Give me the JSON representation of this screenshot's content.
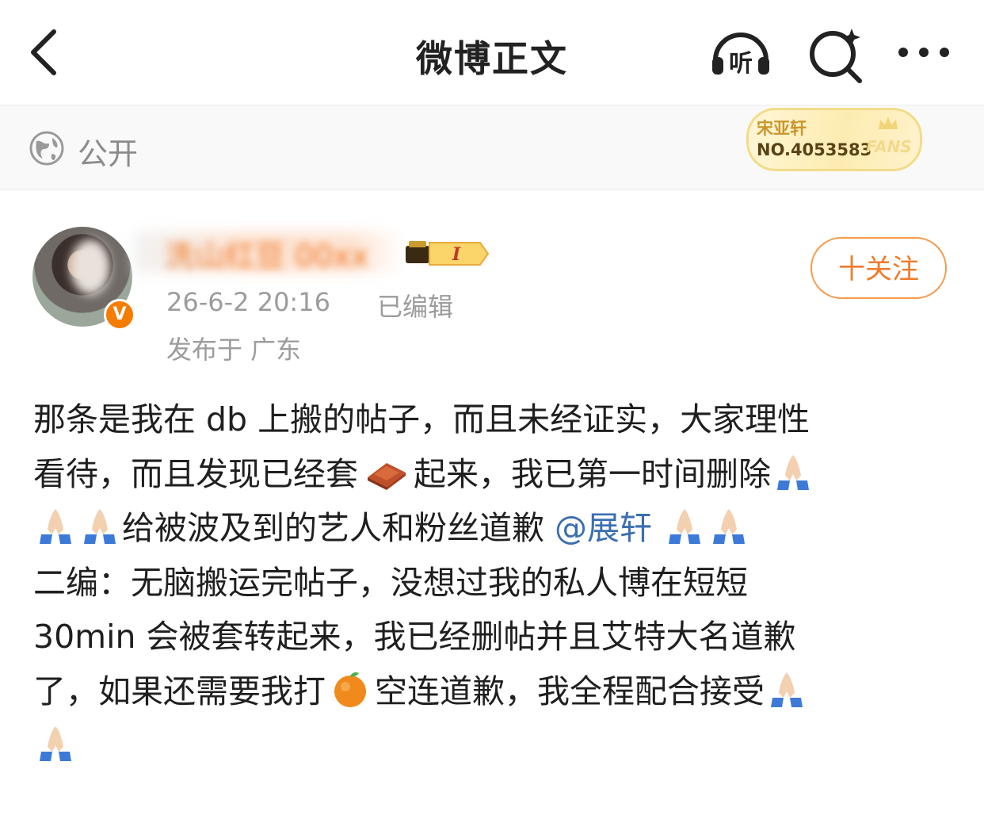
{
  "header": {
    "title": "微博正文",
    "listen_label": "听"
  },
  "visibility": {
    "label": "公开"
  },
  "fans_badge": {
    "name": "宋亚轩",
    "number": "NO.4053583",
    "mark": "FANS"
  },
  "author": {
    "name": "洗山红豆 00xx",
    "verified_mark": "V",
    "timestamp": "26-6-2 20:16",
    "edited": "已编辑",
    "location": "发布于 广东",
    "level_mark": "I"
  },
  "follow_button": {
    "label": "十关注"
  },
  "post": {
    "line1": "那条是我在 db 上搬的帖子，而且未经证实，大家理性",
    "line2a": "看待，而且发现已经套",
    "line2b": "起来，我已第一时间删除",
    "line3a": "给被波及到的艺人和粉丝道歉 ",
    "mention": "@展轩",
    "line4": "二编：无脑搬运完帖子，没想过我的私人博在短短",
    "line5": " 30min 会被套转起来，我已经删帖并且艾特大名道歉",
    "line6a": "了，如果还需要我打",
    "line6b": "空连道歉，我全程配合接受"
  },
  "colors": {
    "accent": "#f07a2a",
    "link": "#3b6fb0",
    "meta": "#9c9c9c"
  },
  "icons": [
    "back-icon",
    "listen-icon",
    "search-icon",
    "more-icon",
    "globe-icon",
    "brick-emoji",
    "orange-emoji",
    "pray-emoji"
  ]
}
